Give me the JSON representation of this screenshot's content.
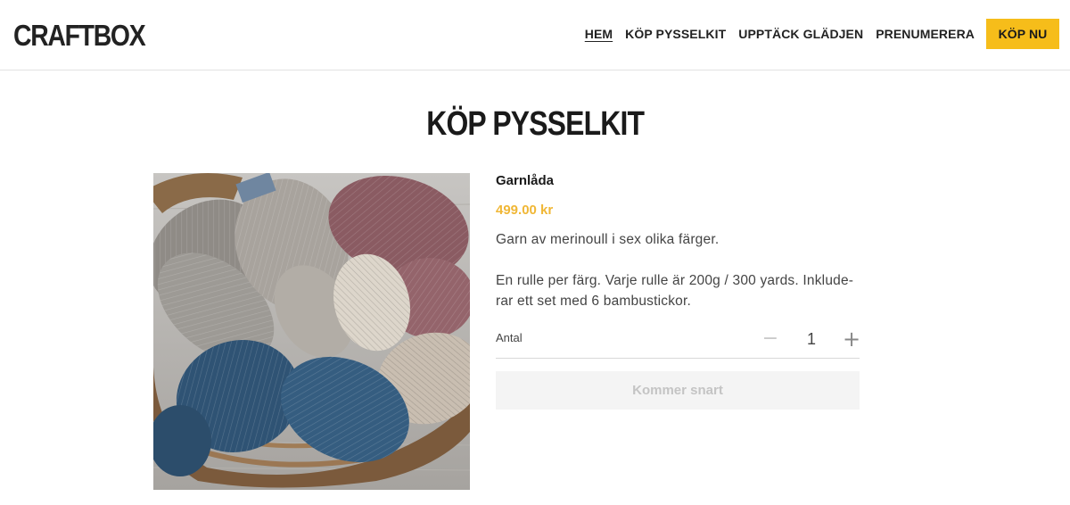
{
  "header": {
    "logo": "CRAFTBOX",
    "nav": [
      {
        "label": "HEM",
        "active": true
      },
      {
        "label": "KÖP PYSSELKIT"
      },
      {
        "label": "UPPTÄCK GLÄDJEN"
      },
      {
        "label": "PRENUMERERA"
      }
    ],
    "cta_label": "KÖP NU",
    "accent_color": "#f6bd1a"
  },
  "page": {
    "title": "KÖP PYSSELKIT"
  },
  "product": {
    "image_icon": "yarn-basket-photo",
    "name": "Garnlåda",
    "price": "499.00 kr",
    "price_color": "#f0b736",
    "description": [
      "Garn av merinoull i sex olika färger.",
      "En rulle per färg. Varje rulle är 200g / 300 yards. Inklude-rar ett set med 6 bambustickor."
    ],
    "quantity_label": "Antal",
    "quantity_value": "1",
    "minus_icon": "minus-icon",
    "plus_icon": "plus-icon",
    "button_label": "Kommer snart"
  }
}
